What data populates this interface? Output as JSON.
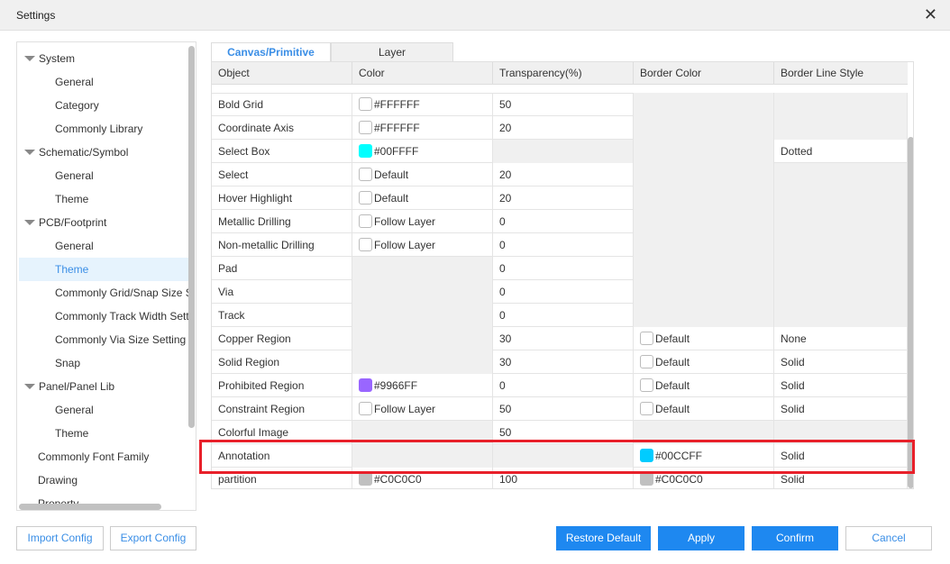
{
  "window": {
    "title": "Settings",
    "close_icon": "close-icon"
  },
  "tree": [
    {
      "label": "System",
      "level": 0,
      "expanded": true
    },
    {
      "label": "General",
      "level": 1
    },
    {
      "label": "Category",
      "level": 1
    },
    {
      "label": "Commonly Library",
      "level": 1
    },
    {
      "label": "Schematic/Symbol",
      "level": 0,
      "expanded": true
    },
    {
      "label": "General",
      "level": 1
    },
    {
      "label": "Theme",
      "level": 1
    },
    {
      "label": "PCB/Footprint",
      "level": 0,
      "expanded": true
    },
    {
      "label": "General",
      "level": 1
    },
    {
      "label": "Theme",
      "level": 1,
      "selected": true
    },
    {
      "label": "Commonly Grid/Snap Size Setting",
      "level": 1
    },
    {
      "label": "Commonly Track Width Setting",
      "level": 1
    },
    {
      "label": "Commonly Via Size Setting",
      "level": 1
    },
    {
      "label": "Snap",
      "level": 1
    },
    {
      "label": "Panel/Panel Lib",
      "level": 0,
      "expanded": true
    },
    {
      "label": "General",
      "level": 1
    },
    {
      "label": "Theme",
      "level": 1
    },
    {
      "label": "Commonly Font Family",
      "level": 0
    },
    {
      "label": "Drawing",
      "level": 0
    },
    {
      "label": "Property",
      "level": 0
    }
  ],
  "tabs": [
    {
      "label": "Canvas/Primitive",
      "active": true
    },
    {
      "label": "Layer",
      "active": false
    }
  ],
  "columns": [
    "Object",
    "Color",
    "Transparency(%)",
    "Border Color",
    "Border Line Style"
  ],
  "rows": [
    {
      "object": "Bold Grid",
      "color": {
        "swatch": "#FFFFFF",
        "text": "#FFFFFF"
      },
      "transparency": "50",
      "border_color": null,
      "border_style": null
    },
    {
      "object": "Coordinate Axis",
      "color": {
        "swatch": "#FFFFFF",
        "text": "#FFFFFF"
      },
      "transparency": "20",
      "border_color": null,
      "border_style": null
    },
    {
      "object": "Select Box",
      "color": {
        "swatch": "#00FFFF",
        "text": "#00FFFF"
      },
      "transparency": null,
      "border_color": null,
      "border_style": "Dotted"
    },
    {
      "object": "Select",
      "color": {
        "swatch": "#FFFFFF",
        "text": "Default"
      },
      "transparency": "20",
      "border_color": null,
      "border_style": null
    },
    {
      "object": "Hover Highlight",
      "color": {
        "swatch": "#FFFFFF",
        "text": "Default"
      },
      "transparency": "20",
      "border_color": null,
      "border_style": null
    },
    {
      "object": "Metallic Drilling",
      "color": {
        "swatch": "#FFFFFF",
        "text": "Follow Layer"
      },
      "transparency": "0",
      "border_color": null,
      "border_style": null
    },
    {
      "object": "Non-metallic Drilling",
      "color": {
        "swatch": "#FFFFFF",
        "text": "Follow Layer"
      },
      "transparency": "0",
      "border_color": null,
      "border_style": null
    },
    {
      "object": "Pad",
      "color": null,
      "transparency": "0",
      "border_color": null,
      "border_style": null
    },
    {
      "object": "Via",
      "color": null,
      "transparency": "0",
      "border_color": null,
      "border_style": null
    },
    {
      "object": "Track",
      "color": null,
      "transparency": "0",
      "border_color": null,
      "border_style": null
    },
    {
      "object": "Copper Region",
      "color": null,
      "transparency": "30",
      "border_color": {
        "swatch": "#FFFFFF",
        "text": "Default"
      },
      "border_style": "None"
    },
    {
      "object": "Solid Region",
      "color": null,
      "transparency": "30",
      "border_color": {
        "swatch": "#FFFFFF",
        "text": "Default"
      },
      "border_style": "Solid"
    },
    {
      "object": "Prohibited Region",
      "color": {
        "swatch": "#9966FF",
        "text": "#9966FF"
      },
      "transparency": "0",
      "border_color": {
        "swatch": "#FFFFFF",
        "text": "Default"
      },
      "border_style": "Solid"
    },
    {
      "object": "Constraint Region",
      "color": {
        "swatch": "#FFFFFF",
        "text": "Follow Layer"
      },
      "transparency": "50",
      "border_color": {
        "swatch": "#FFFFFF",
        "text": "Default"
      },
      "border_style": "Solid"
    },
    {
      "object": "Colorful Image",
      "color": null,
      "transparency": "50",
      "border_color": null,
      "border_style": null
    },
    {
      "object": "Annotation",
      "color": null,
      "transparency": null,
      "border_color": {
        "swatch": "#00CCFF",
        "text": "#00CCFF"
      },
      "border_style": "Solid",
      "highlighted": true
    },
    {
      "object": "partition",
      "color": {
        "swatch": "#C0C0C0",
        "text": "#C0C0C0"
      },
      "transparency": "100",
      "border_color": {
        "swatch": "#C0C0C0",
        "text": "#C0C0C0"
      },
      "border_style": "Solid"
    }
  ],
  "buttons": {
    "import": "Import Config",
    "export": "Export Config",
    "restore": "Restore Default",
    "apply": "Apply",
    "confirm": "Confirm",
    "cancel": "Cancel"
  },
  "colors": {
    "accent": "#1E88F0",
    "highlight_box": "#E8202A",
    "selected_bg": "#E6F3FD"
  }
}
